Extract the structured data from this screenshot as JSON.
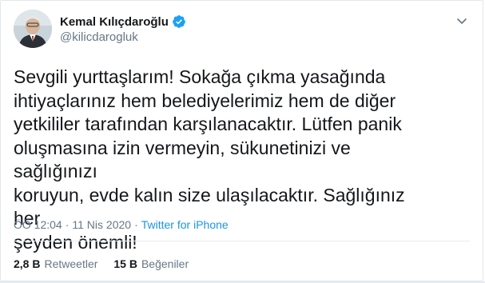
{
  "author": {
    "display_name": "Kemal Kılıçdaroğlu",
    "handle": "@kilicdarogluk",
    "verified": true
  },
  "tweet": {
    "text": "Sevgili yurttaşlarım! Sokağa çıkma yasağında\nihtiyaçlarınız hem belediyelerimiz hem de diğer\nyetkililer tarafından karşılanacaktır. Lütfen panik\noluşmasına izin vermeyin, sükunetinizi ve sağlığınızı\nkoruyun, evde kalın size ulaşılacaktır. Sağlığınız her\nşeyden önemli!",
    "time": "ÖÖ 12:04",
    "separator": "·",
    "date": "11 Nis 2020",
    "source": "Twitter for iPhone"
  },
  "stats": {
    "retweets_count": "2,8 B",
    "retweets_label": "Retweetler",
    "likes_count": "15 B",
    "likes_label": "Beğeniler"
  },
  "colors": {
    "verified_badge": "#1da1f2",
    "link": "#1b95e0",
    "muted": "#657786"
  },
  "icons": {
    "verified": "verified-badge-icon",
    "more": "chevron-down-icon"
  }
}
